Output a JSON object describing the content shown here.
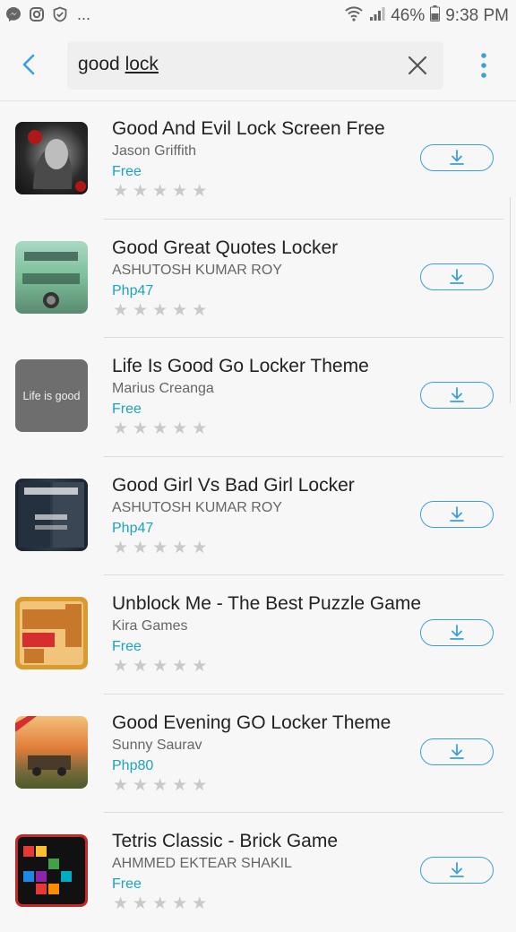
{
  "status_bar": {
    "battery": "46%",
    "time": "9:38 PM",
    "more": "..."
  },
  "search": {
    "query_plain": "good ",
    "query_underlined": "lock"
  },
  "apps": [
    {
      "title": "Good And Evil Lock Screen Free",
      "developer": "Jason Griffith",
      "price": "Free",
      "stars": 0
    },
    {
      "title": "Good Great Quotes Locker",
      "developer": "ASHUTOSH KUMAR ROY",
      "price": "Php47",
      "stars": 0
    },
    {
      "title": "Life Is Good Go Locker Theme",
      "developer": "Marius Creanga",
      "price": "Free",
      "stars": 0,
      "thumb_text": "Life is good"
    },
    {
      "title": "Good Girl Vs Bad Girl Locker",
      "developer": "ASHUTOSH KUMAR ROY",
      "price": "Php47",
      "stars": 0
    },
    {
      "title": "Unblock Me - The Best Puzzle Game",
      "developer": "Kira Games",
      "price": "Free",
      "stars": 0
    },
    {
      "title": "Good Evening GO Locker Theme",
      "developer": "Sunny Saurav",
      "price": "Php80",
      "stars": 0
    },
    {
      "title": "Tetris Classic - Brick Game",
      "developer": "AHMMED EKTEAR SHAKIL",
      "price": "Free",
      "stars": 0
    }
  ],
  "colors": {
    "accent": "#3aa0dc",
    "price": "#1aa3c2",
    "star_empty": "#c9c9c9"
  }
}
